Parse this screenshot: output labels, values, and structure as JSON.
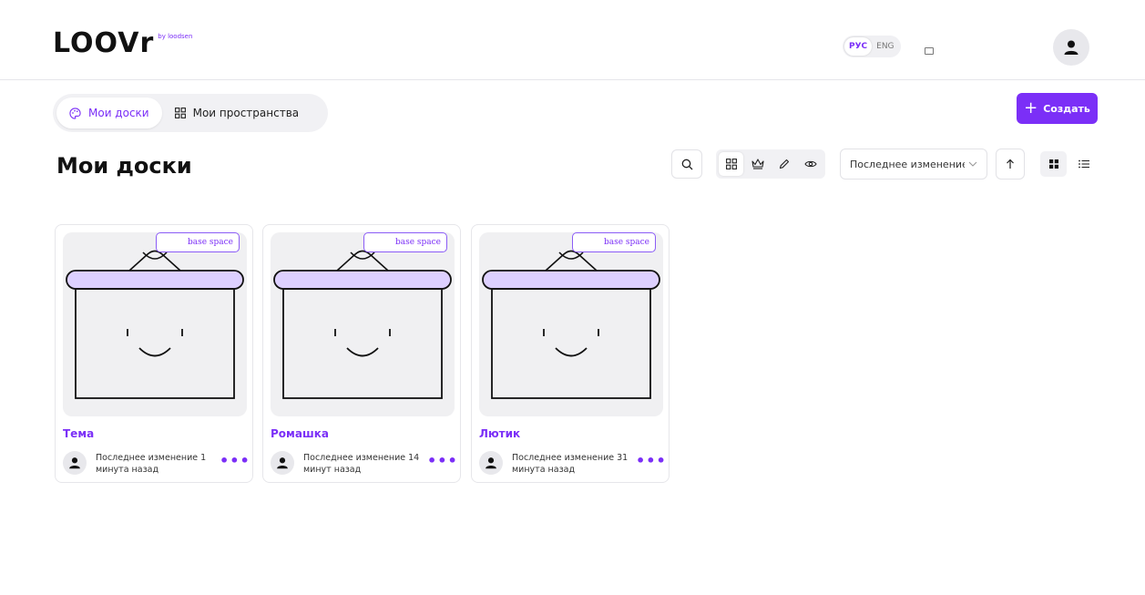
{
  "header": {
    "logo_text": "LOOVr",
    "logo_by": "by loodsen",
    "lang_ru": "РУС",
    "lang_en": "ENG"
  },
  "tabs": [
    {
      "label": "Мои доски",
      "icon": "palette-icon",
      "active": true
    },
    {
      "label": "Мои пространства",
      "icon": "grid-icon",
      "active": false
    }
  ],
  "create_label": "Создать",
  "page_title": "Мои доски",
  "sort": {
    "selected": "Последнее изменение"
  },
  "boards": [
    {
      "title": "Тема",
      "space": "base space",
      "meta": "Последнее изменение 1 минута назад"
    },
    {
      "title": "Ромашка",
      "space": "base space",
      "meta": "Последнее изменение 14 минут назад"
    },
    {
      "title": "Лютик",
      "space": "base space",
      "meta": "Последнее изменение 31 минута назад"
    }
  ],
  "colors": {
    "accent": "#7b2ff7",
    "board_top": "#ddd0ff"
  }
}
